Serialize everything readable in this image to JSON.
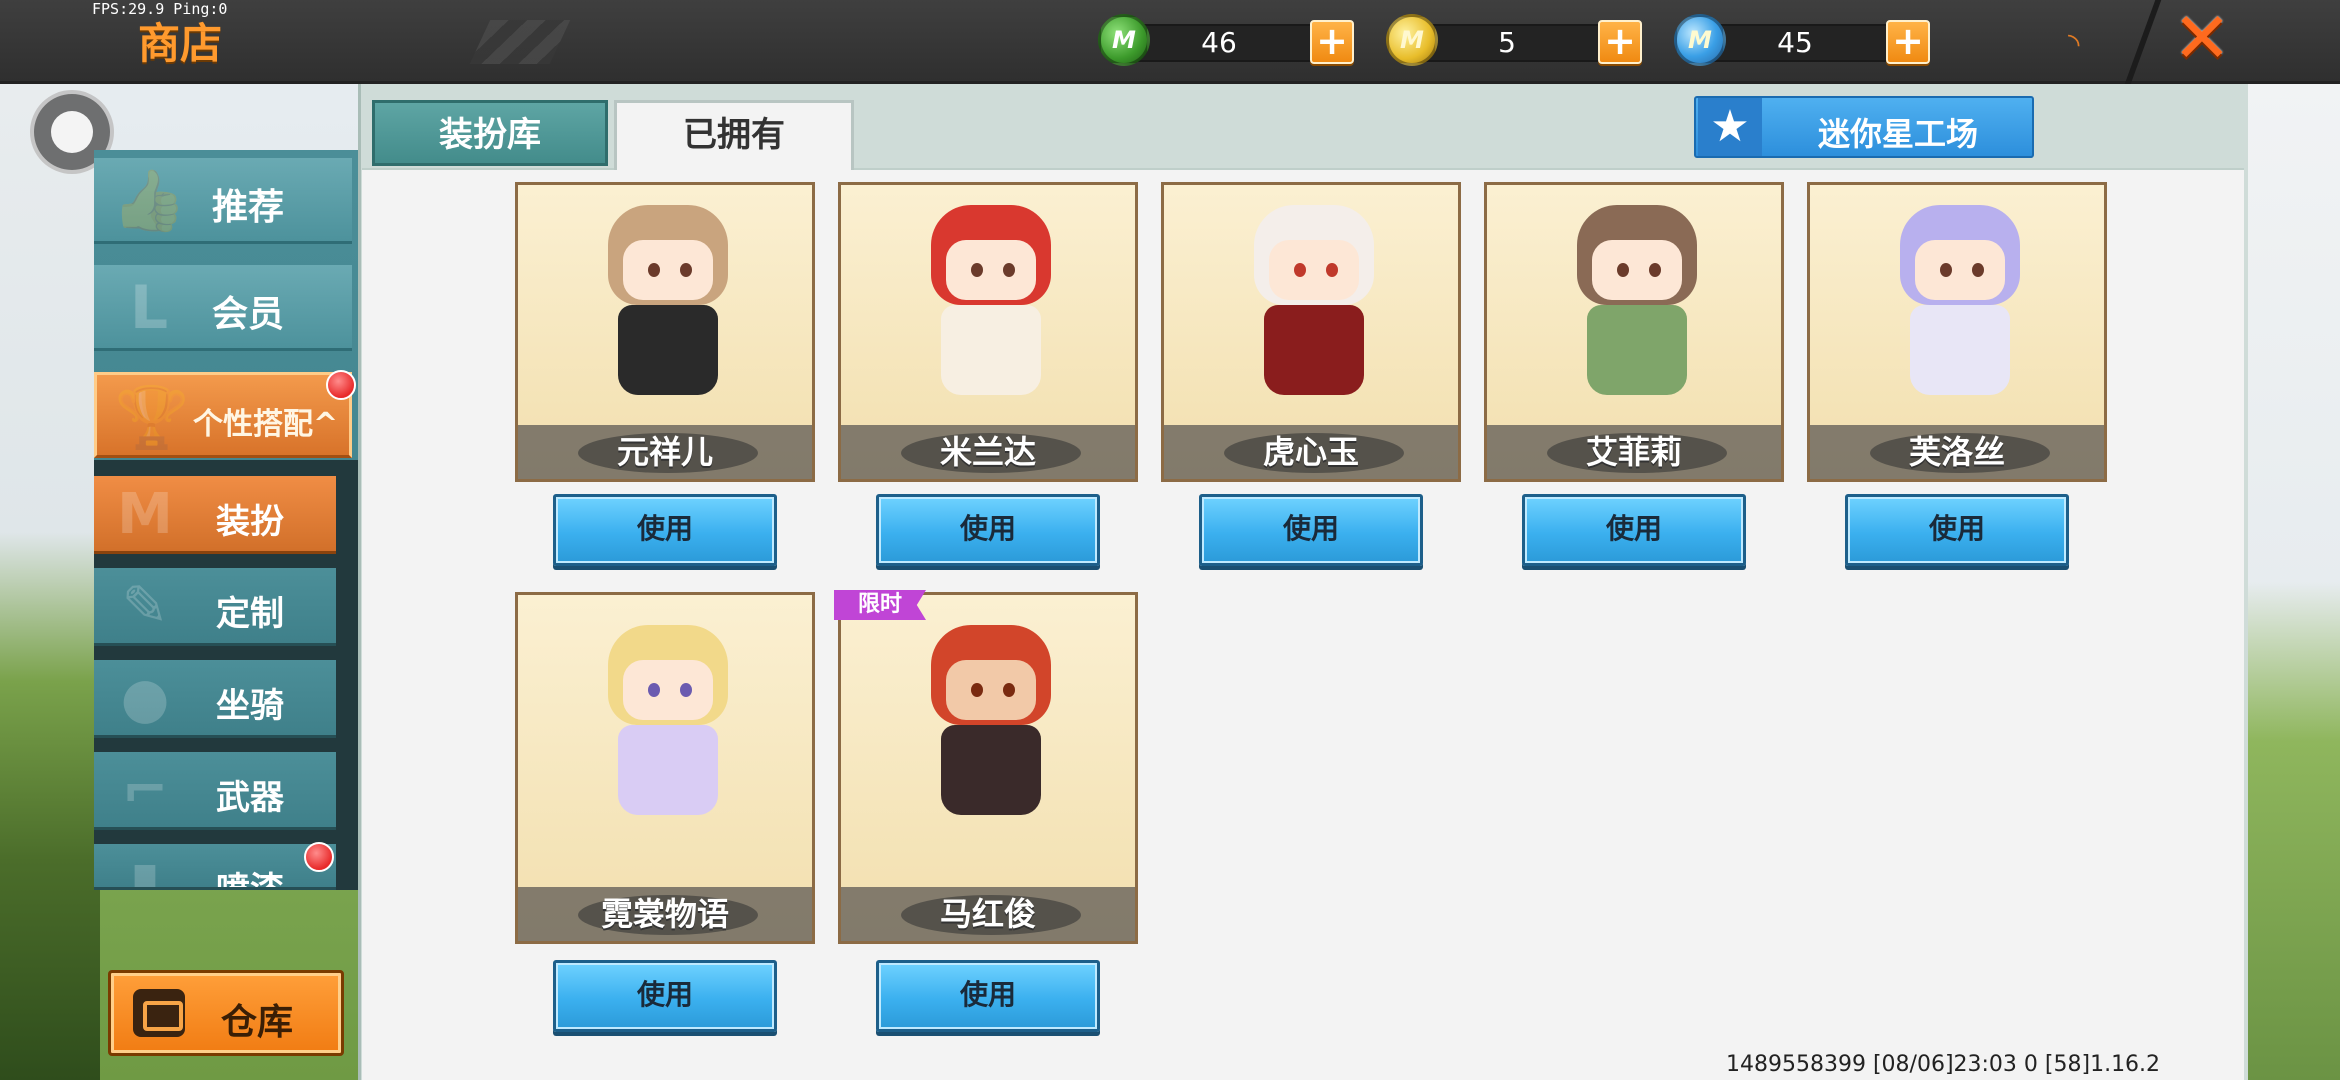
{
  "status": {
    "fps": "FPS:29.9  Ping:0"
  },
  "header": {
    "title": "商店",
    "currencies": [
      {
        "icon": "green-mini-coin-icon",
        "glyph": "M",
        "value": "46"
      },
      {
        "icon": "gold-mini-coin-icon",
        "glyph": "M",
        "value": "5"
      },
      {
        "icon": "blue-mini-bean-icon",
        "glyph": "M",
        "value": "45"
      }
    ],
    "plus_glyph": "+",
    "close_glyph": "✕",
    "rss_glyph": "◝"
  },
  "sidebar": {
    "items": [
      {
        "label": "推荐",
        "icon": "thumbs-up-icon",
        "glyph": "👍"
      },
      {
        "label": "会员",
        "icon": "member-card-icon",
        "glyph": "L"
      },
      {
        "label": "个性搭配^",
        "icon": "trophy-icon",
        "glyph": "🏆"
      }
    ],
    "sub_items": [
      {
        "label": "装扮",
        "icon": "shirt-icon",
        "glyph": "M"
      },
      {
        "label": "定制",
        "icon": "pencil-icon",
        "glyph": "✎"
      },
      {
        "label": "坐骑",
        "icon": "paw-icon",
        "glyph": "●"
      },
      {
        "label": "武器",
        "icon": "gun-icon",
        "glyph": "⌐"
      },
      {
        "label": "喷漆",
        "icon": "spray-can-icon",
        "glyph": "▮"
      }
    ],
    "warehouse_label": "仓库"
  },
  "tabs": [
    {
      "label": "装扮库"
    },
    {
      "label": "已拥有"
    }
  ],
  "star_button": {
    "label": "迷你星工场",
    "glyph": "★"
  },
  "use_label": "使用",
  "limited_label": "限时",
  "cards": [
    {
      "name": "元祥儿",
      "hair": "#c9a47e",
      "outfit": "#2a2a2a"
    },
    {
      "name": "米兰达",
      "hair": "#d9382f",
      "outfit": "#f7efe2"
    },
    {
      "name": "虎心玉",
      "hair": "#f4eeea",
      "outfit": "#8a1d1d"
    },
    {
      "name": "艾菲莉",
      "hair": "#8a6a55",
      "outfit": "#7fa56a"
    },
    {
      "name": "芙洛丝",
      "hair": "#b8b0ee",
      "outfit": "#e8e6f6"
    },
    {
      "name": "霓裳物语",
      "hair": "#f2d98a",
      "outfit": "#d9ccf4"
    },
    {
      "name": "马红俊",
      "hair": "#d2452a",
      "outfit": "#3a2a2a"
    }
  ],
  "footer": {
    "version": "1489558399   [08/06]23:03 0 [58]1.16.2"
  }
}
